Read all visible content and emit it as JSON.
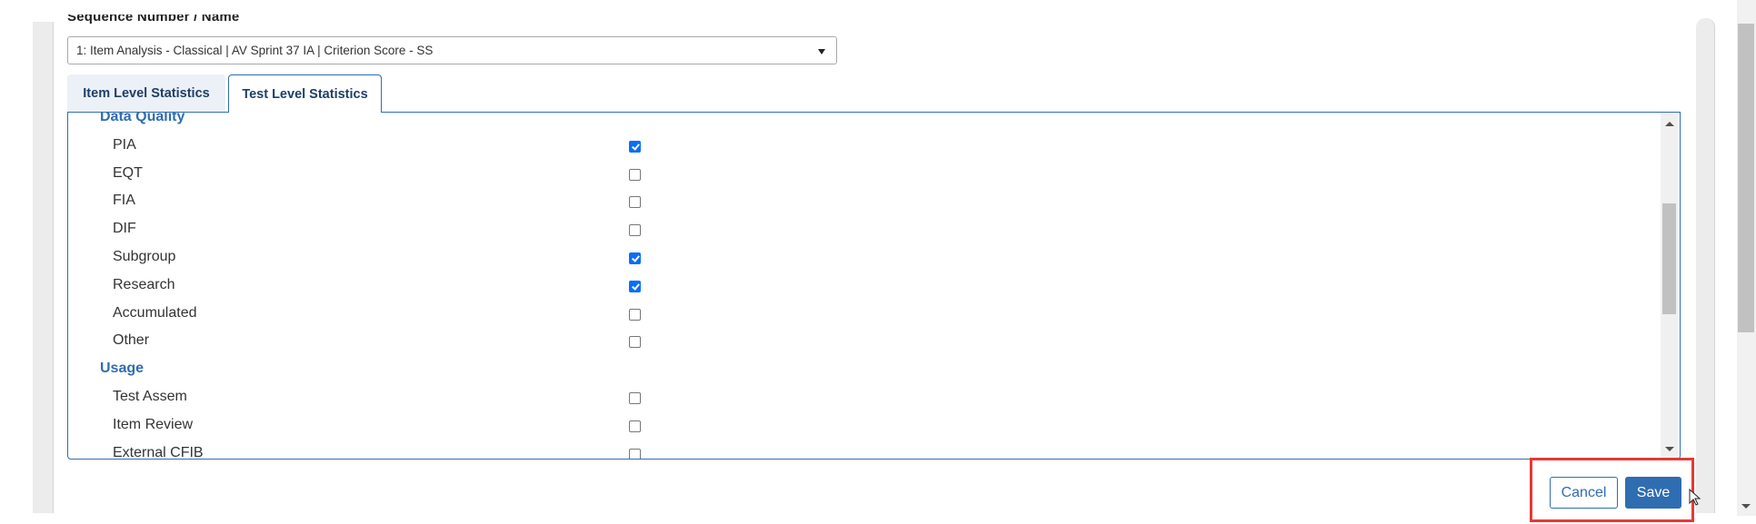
{
  "field": {
    "label": "Sequence Number / Name",
    "select_value": "1: Item Analysis - Classical | AV Sprint 37 IA | Criterion Score - SS"
  },
  "tabs": [
    {
      "label": "Item Level Statistics",
      "active": false
    },
    {
      "label": "Test Level Statistics",
      "active": true
    }
  ],
  "sections": [
    {
      "title": "Data Quality",
      "items": [
        {
          "label": "PIA",
          "checked": true
        },
        {
          "label": "EQT",
          "checked": false
        },
        {
          "label": "FIA",
          "checked": false
        },
        {
          "label": "DIF",
          "checked": false
        },
        {
          "label": "Subgroup",
          "checked": true
        },
        {
          "label": "Research",
          "checked": true
        },
        {
          "label": "Accumulated",
          "checked": false
        },
        {
          "label": "Other",
          "checked": false
        }
      ]
    },
    {
      "title": "Usage",
      "items": [
        {
          "label": "Test Assem",
          "checked": false
        },
        {
          "label": "Item Review",
          "checked": false
        },
        {
          "label": "External CFIB",
          "checked": false
        }
      ]
    }
  ],
  "buttons": {
    "cancel": "Cancel",
    "save": "Save"
  },
  "colors": {
    "accent": "#2f6db1",
    "checkbox": "#0b6ef7",
    "highlight": "#e53935"
  }
}
